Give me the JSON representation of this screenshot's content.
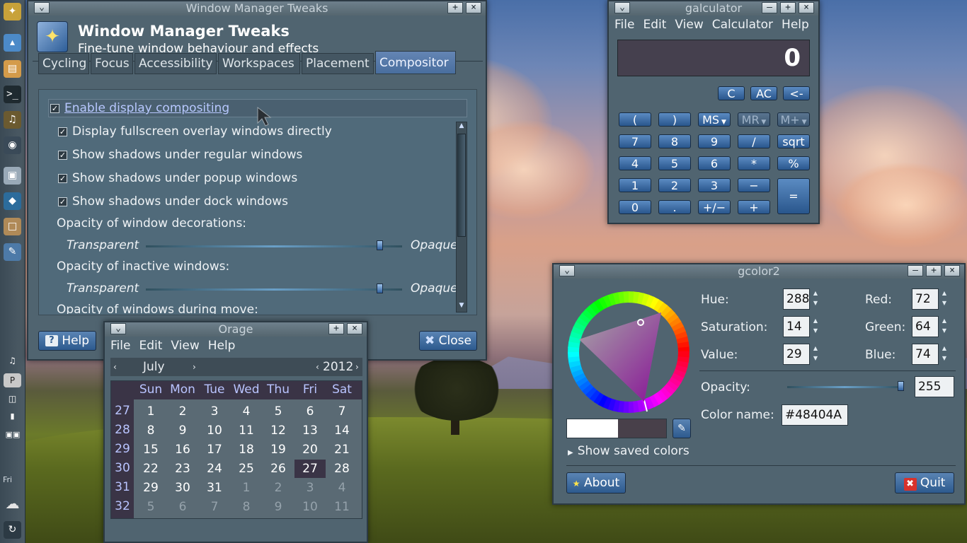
{
  "desktop": {
    "panel_day": "Fri"
  },
  "wmtweaks": {
    "window_title": "Window Manager Tweaks",
    "header_title": "Window Manager Tweaks",
    "header_subtitle": "Fine-tune window behaviour and effects",
    "tabs": [
      "Cycling",
      "Focus",
      "Accessibility",
      "Workspaces",
      "Placement",
      "Compositor"
    ],
    "active_tab": "Compositor",
    "enable_compositing": "Enable display compositing",
    "options": [
      "Display fullscreen overlay windows directly",
      "Show shadows under regular windows",
      "Show shadows under popup windows",
      "Show shadows under dock windows"
    ],
    "opacity_decorations_label": "Opacity of window decorations:",
    "opacity_inactive_label": "Opacity of inactive windows:",
    "opacity_move_label": "Opacity of windows during move:",
    "transparent": "Transparent",
    "opaque": "Opaque",
    "help": "Help",
    "close": "Close"
  },
  "calc": {
    "window_title": "galculator",
    "menu": [
      "File",
      "Edit",
      "View",
      "Calculator",
      "Help"
    ],
    "display": "0",
    "btn_c": "C",
    "btn_ac": "AC",
    "btn_back": "<-",
    "btn_lparen": "(",
    "btn_rparen": ")",
    "btn_ms": "MS",
    "btn_mr": "MR",
    "btn_mplus": "M+",
    "btn_7": "7",
    "btn_8": "8",
    "btn_9": "9",
    "btn_div": "/",
    "btn_sqrt": "sqrt",
    "btn_4": "4",
    "btn_5": "5",
    "btn_6": "6",
    "btn_mul": "*",
    "btn_pct": "%",
    "btn_1": "1",
    "btn_2": "2",
    "btn_3": "3",
    "btn_sub": "−",
    "btn_eq": "=",
    "btn_0": "0",
    "btn_dot": ".",
    "btn_sign": "+/−",
    "btn_add": "+"
  },
  "orage": {
    "window_title": "Orage",
    "menu": [
      "File",
      "Edit",
      "View",
      "Help"
    ],
    "month": "July",
    "year": "2012",
    "days": [
      "Sun",
      "Mon",
      "Tue",
      "Wed",
      "Thu",
      "Fri",
      "Sat"
    ],
    "weeks": [
      "27",
      "28",
      "29",
      "30",
      "31",
      "32"
    ],
    "rows": [
      [
        "1",
        "2",
        "3",
        "4",
        "5",
        "6",
        "7"
      ],
      [
        "8",
        "9",
        "10",
        "11",
        "12",
        "13",
        "14"
      ],
      [
        "15",
        "16",
        "17",
        "18",
        "19",
        "20",
        "21"
      ],
      [
        "22",
        "23",
        "24",
        "25",
        "26",
        "27",
        "28"
      ],
      [
        "29",
        "30",
        "31",
        "1",
        "2",
        "3",
        "4"
      ],
      [
        "5",
        "6",
        "7",
        "8",
        "9",
        "10",
        "11"
      ]
    ],
    "today": "27"
  },
  "gcolor": {
    "window_title": "gcolor2",
    "hue_label": "Hue:",
    "hue": "288",
    "sat_label": "Saturation:",
    "sat": "14",
    "val_label": "Value:",
    "val": "29",
    "red_label": "Red:",
    "red": "72",
    "green_label": "Green:",
    "green": "64",
    "blue_label": "Blue:",
    "blue": "74",
    "opacity_label": "Opacity:",
    "opacity": "255",
    "opacity_level": 1.0,
    "colorname_label": "Color name:",
    "colorname": "#48404A",
    "show_saved": "Show saved colors",
    "about": "About",
    "quit": "Quit",
    "current_color": "#48404A"
  }
}
